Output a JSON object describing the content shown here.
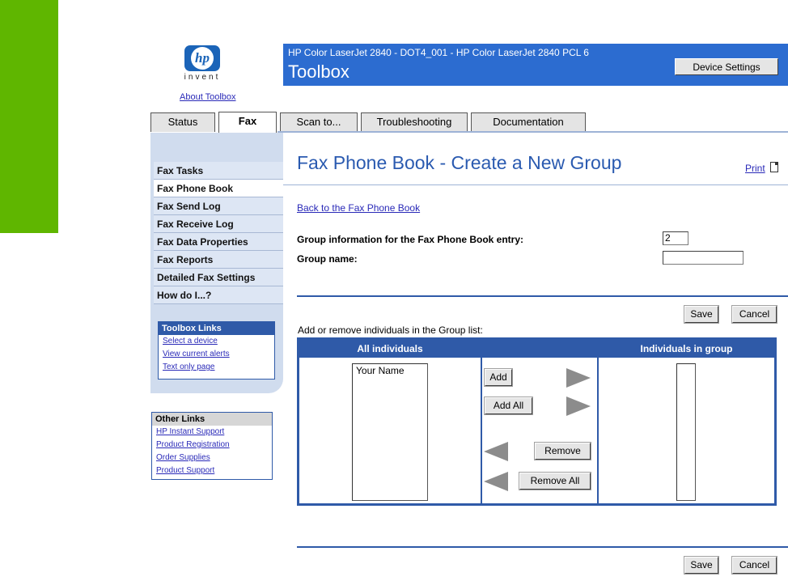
{
  "branding": {
    "logo_text": "hp",
    "tagline": "invent",
    "about_link": "About Toolbox"
  },
  "header": {
    "subtitle": "HP Color LaserJet 2840 - DOT4_001 - HP Color LaserJet 2840 PCL 6",
    "title": "Toolbox",
    "device_settings_label": "Device Settings"
  },
  "tabs": [
    {
      "label": "Status",
      "active": false
    },
    {
      "label": "Fax",
      "active": true
    },
    {
      "label": "Scan to...",
      "active": false
    },
    {
      "label": "Troubleshooting",
      "active": false
    },
    {
      "label": "Documentation",
      "active": false
    }
  ],
  "sidebar": {
    "items": [
      {
        "label": "Fax Tasks",
        "active": false
      },
      {
        "label": "Fax Phone Book",
        "active": true
      },
      {
        "label": "Fax Send Log",
        "active": false
      },
      {
        "label": "Fax Receive Log",
        "active": false
      },
      {
        "label": "Fax Data Properties",
        "active": false
      },
      {
        "label": "Fax Reports",
        "active": false
      },
      {
        "label": "Detailed Fax Settings",
        "active": false
      },
      {
        "label": "How do I...?",
        "active": false
      }
    ],
    "toolbox_links": {
      "heading": "Toolbox Links",
      "links": [
        "Select a device",
        "View current alerts",
        "Text only page"
      ]
    },
    "other_links": {
      "heading": "Other Links",
      "links": [
        "HP Instant Support",
        "Product Registration",
        "Order Supplies",
        "Product Support"
      ]
    }
  },
  "main": {
    "heading": "Fax Phone Book - Create a New Group",
    "print_label": "Print",
    "back_link": "Back to the Fax Phone Book",
    "group_info_label": "Group information for the Fax Phone Book entry:",
    "group_info_value": "2",
    "group_name_label": "Group name:",
    "group_name_value": "",
    "save_label": "Save",
    "cancel_label": "Cancel",
    "instructions": "Add or remove individuals in the Group list:",
    "table": {
      "col_all": "All individuals",
      "col_middle": "",
      "col_group": "Individuals in group",
      "all_individuals": [
        "Your Name"
      ],
      "group_individuals": [],
      "add_label": "Add",
      "add_all_label": "Add All",
      "remove_label": "Remove",
      "remove_all_label": "Remove All"
    }
  }
}
